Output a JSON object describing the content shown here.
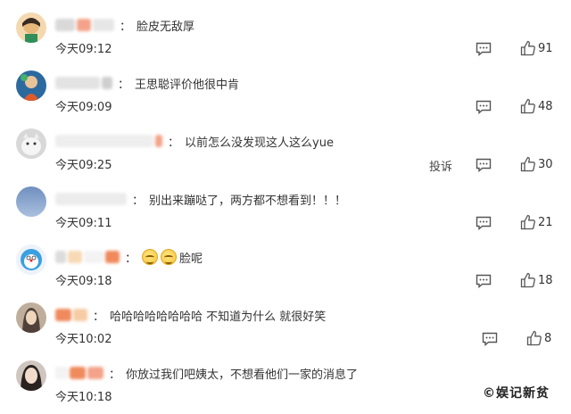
{
  "comments": [
    {
      "text": "脸皮无敌厚",
      "time": "今天09:12",
      "likes": "91"
    },
    {
      "text": "王思聪评价他很中肯",
      "time": "今天09:09",
      "likes": "48"
    },
    {
      "text": "以前怎么没发现这人这么yue",
      "time": "今天09:25",
      "likes": "30",
      "report_label": "投诉"
    },
    {
      "text": "别出来蹦哒了，两方都不想看到！！！",
      "time": "今天09:11",
      "likes": "21"
    },
    {
      "text": "脸呢",
      "time": "今天09:18",
      "likes": "18"
    },
    {
      "text": "哈哈哈哈哈哈哈哈 不知道为什么 就很好笑",
      "time": "今天10:02",
      "likes": "8"
    },
    {
      "text": "你放过我们吧姨太，不想看他们一家的消息了",
      "time": "今天10:18",
      "likes": ""
    }
  ],
  "icons": {
    "reply": "comment-reply-icon",
    "like": "thumbs-up-icon"
  },
  "watermark": "©娱记新贫",
  "colors": {
    "text": "#333333",
    "icon": "#555555",
    "blur_orange": "#f08a5d"
  }
}
